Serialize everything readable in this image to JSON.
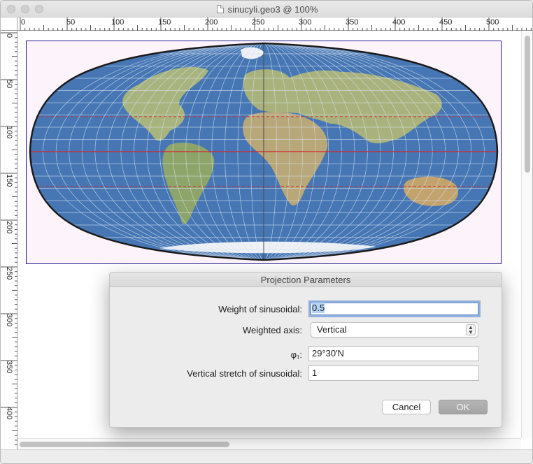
{
  "window": {
    "title": "sinucyli.geo3 @ 100%"
  },
  "ruler": {
    "horizontal_labels": [
      "0",
      "50",
      "100",
      "150",
      "200",
      "250",
      "300",
      "350",
      "400",
      "450",
      "500"
    ],
    "vertical_labels": [
      "0",
      "50",
      "100",
      "150",
      "200",
      "250",
      "300",
      "350",
      "400"
    ]
  },
  "map": {
    "ocean_color": "#4677b4",
    "land_color": "#9fb07a",
    "graticule_color": "#d8e2f0",
    "equator_color": "#d8232a",
    "tropic_color": "#d8232a",
    "outline_color": "#1a1a1a",
    "frame_color": "#1a1f8c"
  },
  "dialog": {
    "title": "Projection Parameters",
    "weight_label": "Weight of sinusoidal:",
    "weight_value": "0.5",
    "axis_label": "Weighted axis:",
    "axis_value": "Vertical",
    "phi_label": "φ₁:",
    "phi_value": "29°30′N",
    "stretch_label": "Vertical stretch of sinusoidal:",
    "stretch_value": "1",
    "cancel_label": "Cancel",
    "ok_label": "OK"
  }
}
